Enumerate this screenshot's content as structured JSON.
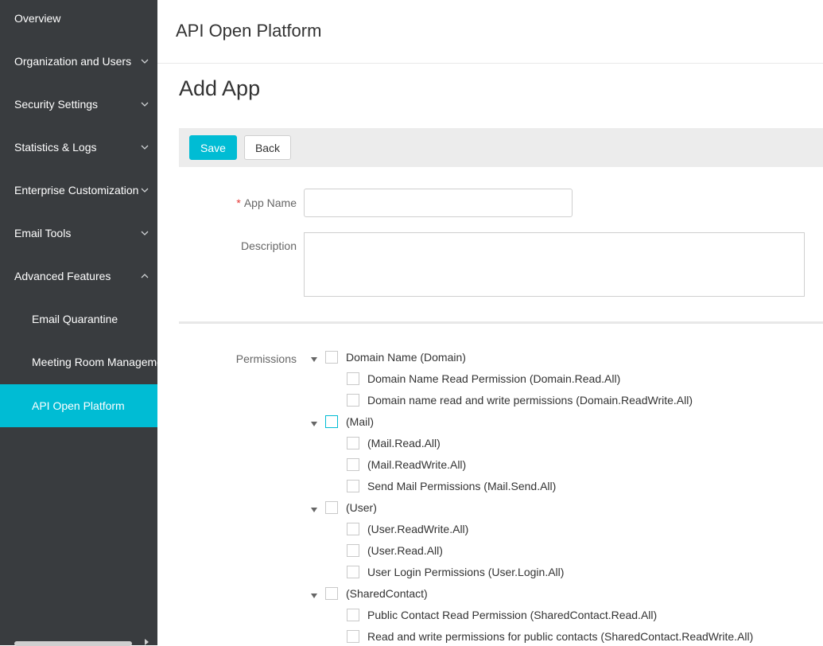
{
  "sidebar": {
    "items": [
      {
        "label": "Overview",
        "chevron": ""
      },
      {
        "label": "Organization and Users",
        "chevron": "down"
      },
      {
        "label": "Security Settings",
        "chevron": "down"
      },
      {
        "label": "Statistics & Logs",
        "chevron": "down"
      },
      {
        "label": "Enterprise Customization",
        "chevron": "down"
      },
      {
        "label": "Email Tools",
        "chevron": "down"
      },
      {
        "label": "Advanced Features",
        "chevron": "up"
      },
      {
        "label": "Email Quarantine",
        "chevron": ""
      },
      {
        "label": "Meeting Room Manageme",
        "chevron": ""
      },
      {
        "label": "API Open Platform",
        "chevron": "",
        "active": true
      }
    ]
  },
  "header": {
    "title": "API Open Platform"
  },
  "page": {
    "title": "Add App"
  },
  "toolbar": {
    "save_label": "Save",
    "back_label": "Back"
  },
  "form": {
    "required_mark": "*",
    "app_name_label": "App Name",
    "app_name_value": "",
    "description_label": "Description",
    "description_value": "",
    "permissions_label": "Permissions"
  },
  "permissions": [
    {
      "label": "Domain Name (Domain)",
      "children": [
        "Domain Name Read Permission (Domain.Read.All)",
        "Domain name read and write permissions (Domain.ReadWrite.All)"
      ]
    },
    {
      "label": "(Mail)",
      "children": [
        "(Mail.Read.All)",
        "(Mail.ReadWrite.All)",
        "Send Mail Permissions (Mail.Send.All)"
      ]
    },
    {
      "label": "(User)",
      "children": [
        "(User.ReadWrite.All)",
        "(User.Read.All)",
        "User Login Permissions (User.Login.All)"
      ]
    },
    {
      "label": "(SharedContact)",
      "children": [
        "Public Contact Read Permission (SharedContact.Read.All)",
        "Read and write permissions for public contacts (SharedContact.ReadWrite.All)"
      ]
    }
  ],
  "colors": {
    "accent": "#00bcd4",
    "sidebar_bg": "#393c3f",
    "required": "#e53935"
  }
}
